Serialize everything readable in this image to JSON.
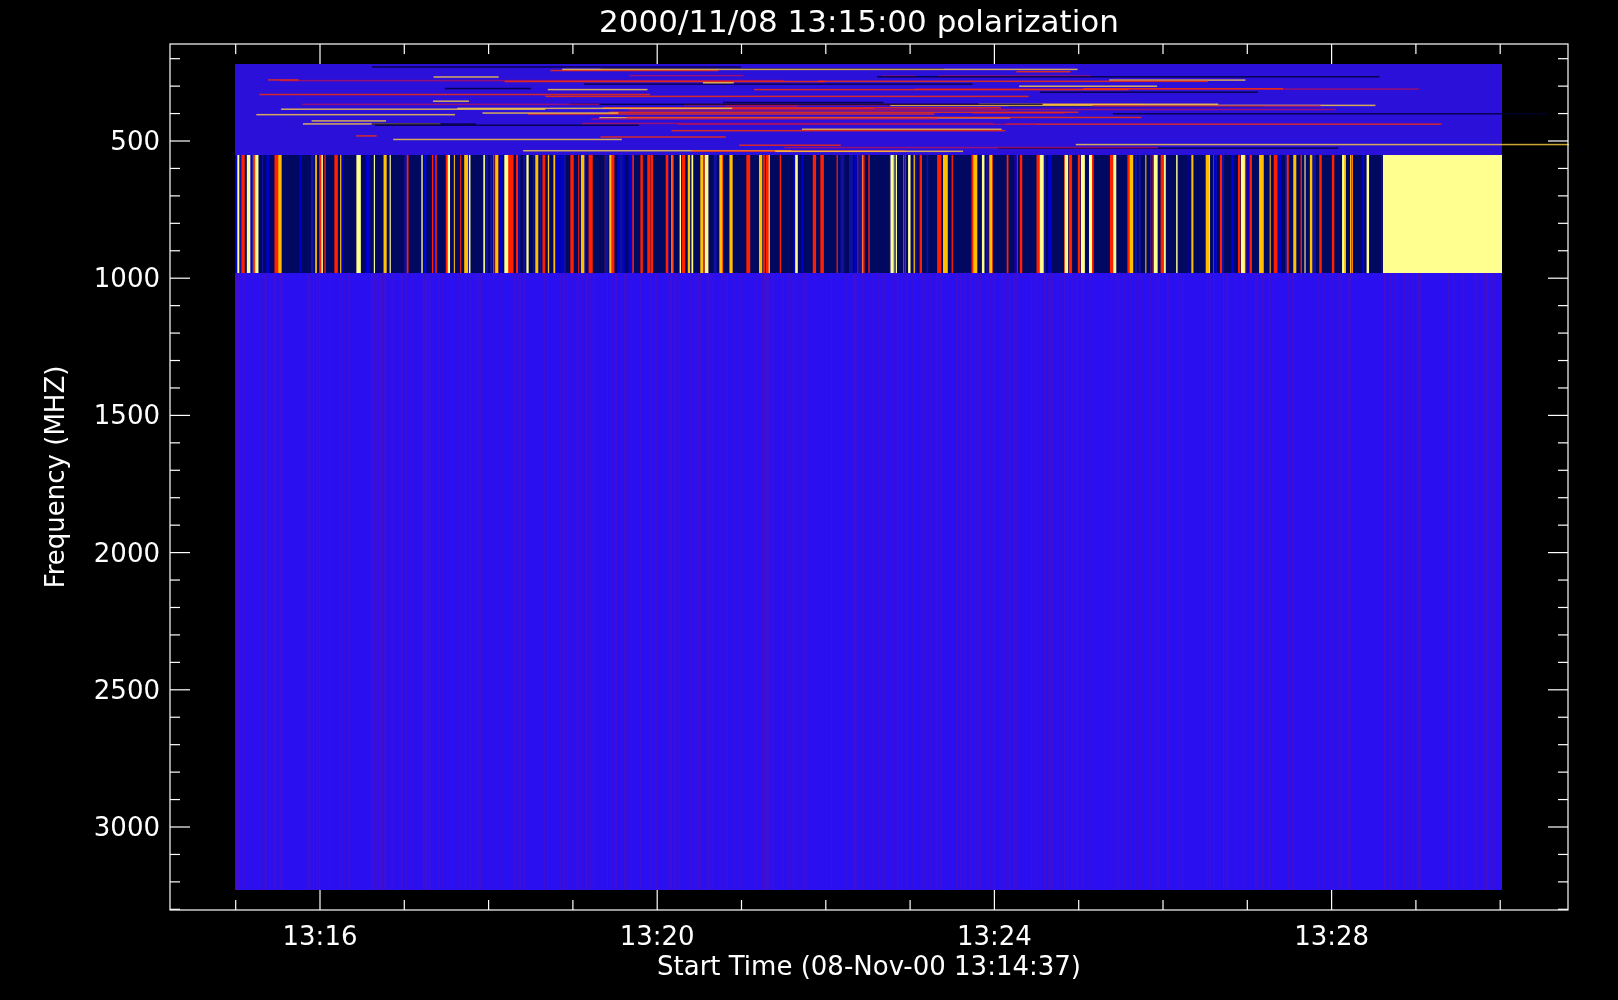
{
  "plot": {
    "title": "2000/11/08 13:15:00 polarization",
    "y_axis": {
      "label": "Frequency (MHZ)",
      "ticks": [
        "500",
        "1000",
        "1500",
        "2000",
        "2500",
        "3000"
      ]
    },
    "x_axis": {
      "label": "Start Time (08-Nov-00 13:14:37)",
      "ticks": [
        "13:16",
        "13:20",
        "13:24",
        "13:28"
      ]
    }
  }
}
